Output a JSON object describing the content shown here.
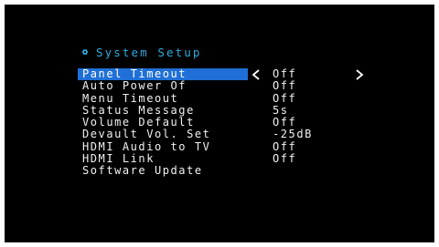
{
  "colors": {
    "background": "#000000",
    "title": "#33aadd",
    "text": "#f2f2f2",
    "highlight": "#1f6fd6"
  },
  "menu": {
    "title": "System Setup",
    "title_icon": "gear-icon",
    "items": [
      {
        "label": "Panel Timeout",
        "value": "Off"
      },
      {
        "label": "Auto Power Of",
        "value": "Off"
      },
      {
        "label": "Menu Timeout",
        "value": "Off"
      },
      {
        "label": "Status Message",
        "value": "5s"
      },
      {
        "label": "Volume Default",
        "value": "Off"
      },
      {
        "label": "Devault Vol. Set",
        "value": "-25dB"
      },
      {
        "label": "HDMI Audio to TV",
        "value": "Off"
      },
      {
        "label": "HDMI Link",
        "value": "Off"
      },
      {
        "label": "Software Update",
        "value": ""
      }
    ],
    "selected_item": "Panel Timeout",
    "arrow_left_icon": "chevron-left-icon",
    "arrow_right_icon": "chevron-right-icon"
  }
}
